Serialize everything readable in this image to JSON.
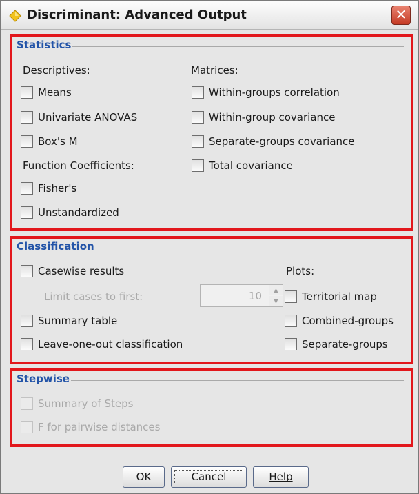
{
  "window": {
    "title": "Discriminant: Advanced Output",
    "close_label": "✕"
  },
  "statistics": {
    "legend": "Statistics",
    "descriptives_label": "Descriptives:",
    "means": "Means",
    "univariate_anovas": "Univariate ANOVAS",
    "boxs_m": "Box's M",
    "function_coefficients_label": "Function Coefficients:",
    "fishers": "Fisher's",
    "unstandardized": "Unstandardized",
    "matrices_label": "Matrices:",
    "within_groups_correlation": "Within-groups correlation",
    "within_group_covariance": "Within-group covariance",
    "separate_groups_covariance": "Separate-groups covariance",
    "total_covariance": "Total covariance"
  },
  "classification": {
    "legend": "Classification",
    "casewise_results": "Casewise results",
    "limit_cases_label": "Limit cases to first:",
    "limit_cases_value": "10",
    "summary_table": "Summary table",
    "leave_one_out": "Leave-one-out classification",
    "plots_label": "Plots:",
    "territorial_map": "Territorial map",
    "combined_groups": "Combined-groups",
    "separate_groups": "Separate-groups"
  },
  "stepwise": {
    "legend": "Stepwise",
    "summary_of_steps": "Summary of Steps",
    "f_pairwise": "F for pairwise distances"
  },
  "buttons": {
    "ok": "OK",
    "cancel": "Cancel",
    "help": "Help"
  },
  "colors": {
    "highlight_border": "#e2171c",
    "legend_text": "#2354a8",
    "dialog_bg": "#e6e6e6"
  },
  "icons": {
    "title_icon": "yellow-diamond-icon",
    "close_icon": "close-icon"
  }
}
